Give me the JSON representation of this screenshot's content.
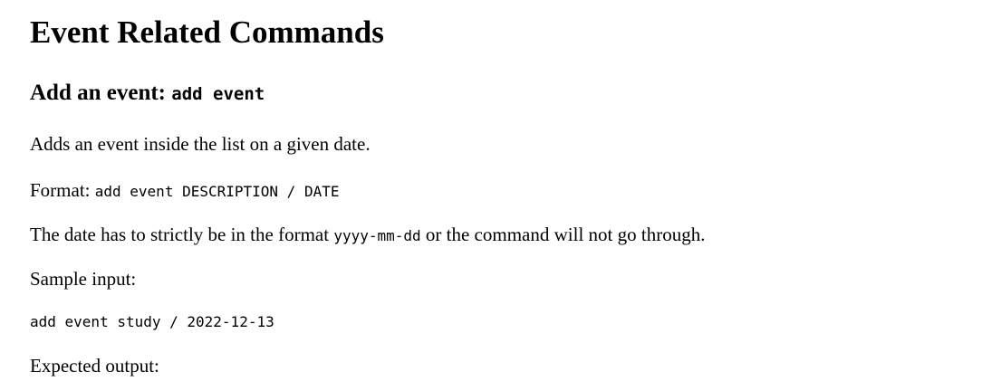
{
  "document": {
    "title": "Event Related Commands",
    "section": {
      "heading_text": "Add an event: ",
      "heading_code": "add event",
      "description": "Adds an event inside the list on a given date.",
      "format_label": "Format: ",
      "format_code": "add event DESCRIPTION / DATE",
      "date_note_before": "The date has to strictly be in the format ",
      "date_note_code": "yyyy-mm-dd",
      "date_note_after": " or the command will not go through.",
      "sample_input_label": "Sample input:",
      "sample_input_code": "add event study / 2022-12-13",
      "expected_output_label": "Expected output:"
    }
  }
}
